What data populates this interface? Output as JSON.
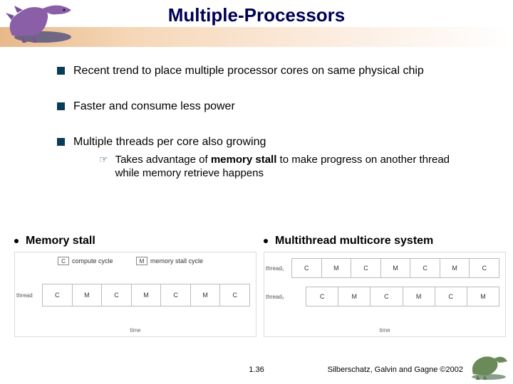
{
  "title": "Multiple-Processors",
  "bullets": {
    "b1": "Recent trend to place multiple processor cores on same physical chip",
    "b2": "Faster and consume less power",
    "b3": "Multiple threads per core also growing",
    "b3_sub_pre": "Takes advantage of ",
    "b3_sub_strong": "memory stall",
    "b3_sub_post": " to make progress on another thread while memory retrieve happens"
  },
  "left": {
    "heading": "Memory stall",
    "legend_c": "C",
    "legend_c_label": "compute cycle",
    "legend_m": "M",
    "legend_m_label": "memory stall cycle",
    "thread_label": "thread",
    "cells": [
      "C",
      "M",
      "C",
      "M",
      "C",
      "M",
      "C"
    ],
    "axis": "time"
  },
  "right": {
    "heading": "Multithread multicore system",
    "thread1_label": "thread₁",
    "thread2_label": "thread₂",
    "row1": [
      "C",
      "M",
      "C",
      "M",
      "C",
      "M",
      "C"
    ],
    "row2": [
      "C",
      "M",
      "C",
      "M",
      "C",
      "M"
    ],
    "axis": "time"
  },
  "footer": {
    "page": "1.36",
    "credit": "Silberschatz, Galvin and  Gagne ©2002"
  }
}
